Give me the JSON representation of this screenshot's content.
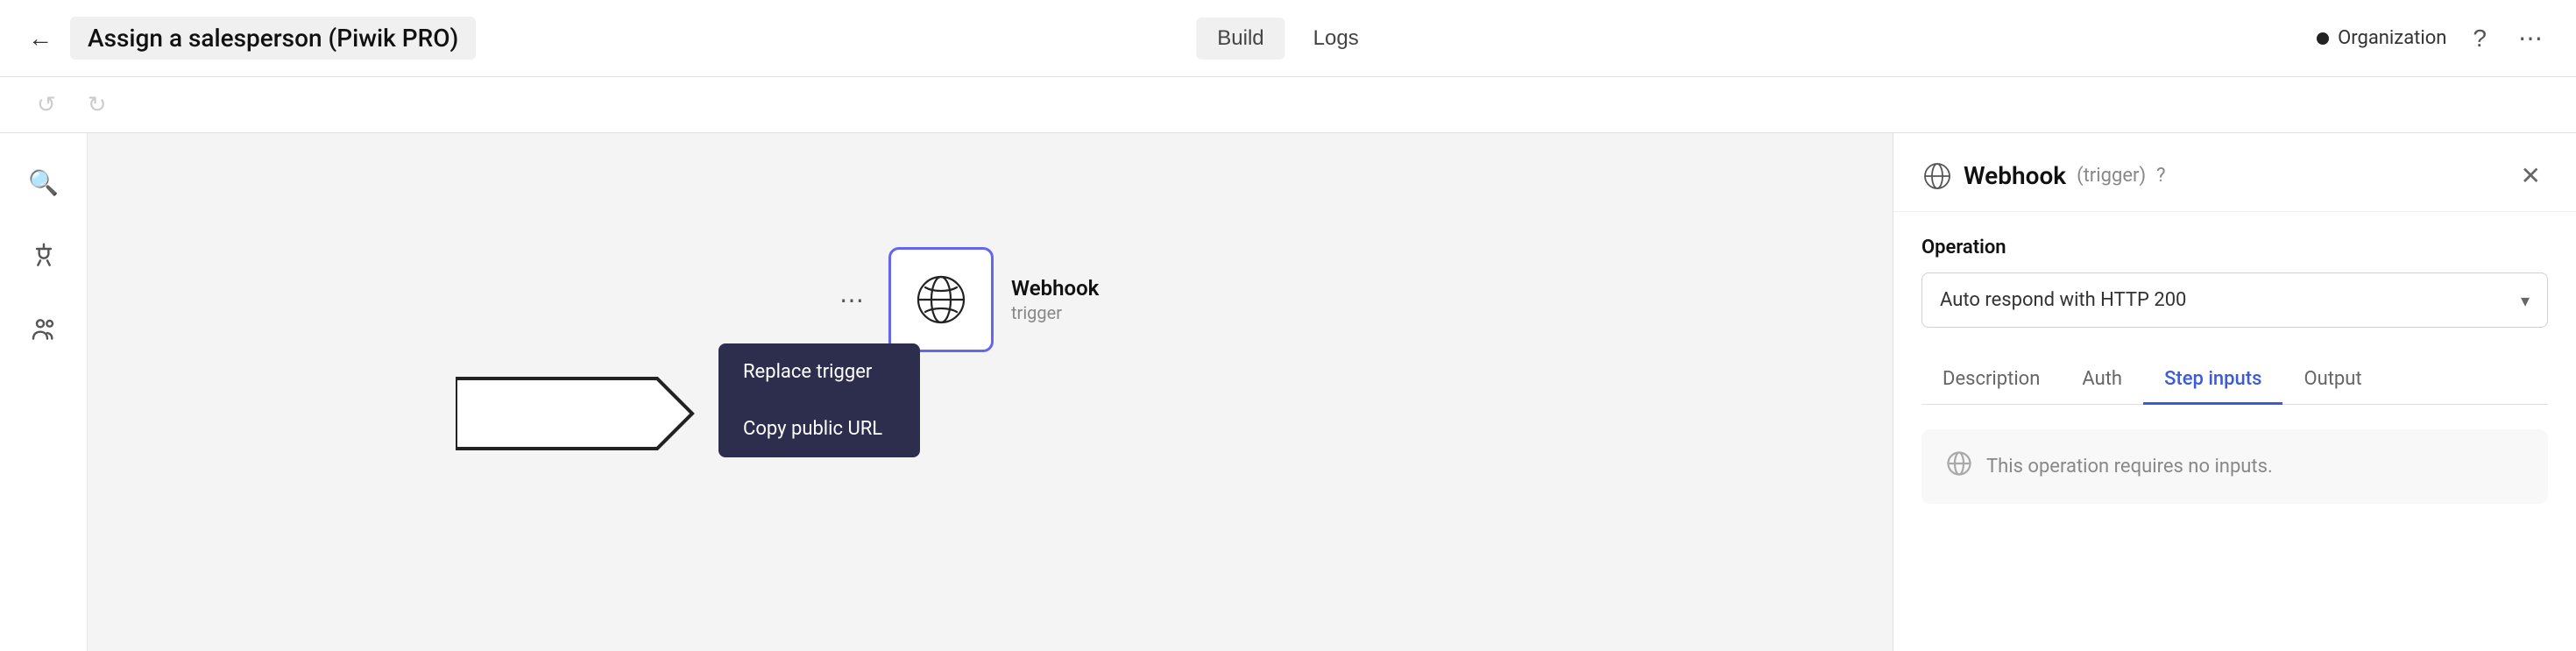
{
  "topbar": {
    "back_label": "←",
    "title": "Assign a salesperson (Piwik PRO)",
    "tabs": [
      {
        "id": "build",
        "label": "Build",
        "active": true
      },
      {
        "id": "logs",
        "label": "Logs",
        "active": false
      }
    ],
    "org_label": "Organization",
    "help_label": "?",
    "more_label": "⋯"
  },
  "toolbar": {
    "undo_label": "↺",
    "redo_label": "↻"
  },
  "sidebar": {
    "items": [
      {
        "id": "search",
        "icon": "🔍"
      },
      {
        "id": "connect",
        "icon": "⚡"
      },
      {
        "id": "team",
        "icon": "👥"
      }
    ]
  },
  "canvas": {
    "node": {
      "name": "Webhook",
      "type": "trigger",
      "more_label": "⋯"
    },
    "context_menu": {
      "items": [
        {
          "id": "replace-trigger",
          "label": "Replace trigger"
        },
        {
          "id": "copy-public-url",
          "label": "Copy public URL"
        }
      ]
    }
  },
  "right_panel": {
    "title": "Webhook",
    "subtitle": "(trigger)",
    "close_label": "✕",
    "operation_label": "Operation",
    "operation_value": "Auto respond with HTTP 200",
    "tabs": [
      {
        "id": "description",
        "label": "Description",
        "active": false
      },
      {
        "id": "auth",
        "label": "Auth",
        "active": false
      },
      {
        "id": "step-inputs",
        "label": "Step inputs",
        "active": true
      },
      {
        "id": "output",
        "label": "Output",
        "active": false
      }
    ],
    "no_inputs_text": "This operation requires no inputs."
  }
}
